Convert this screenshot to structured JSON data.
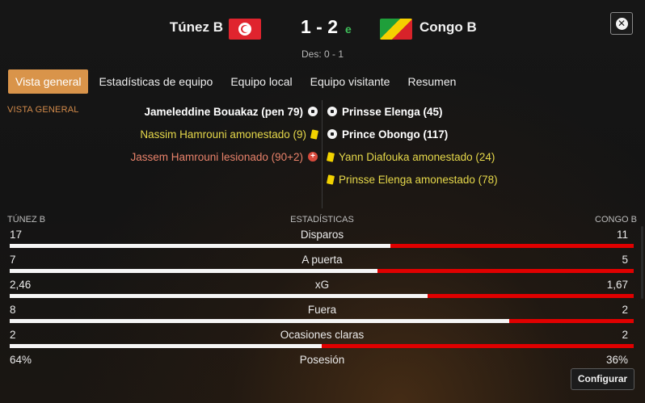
{
  "header": {
    "home_team": "Túnez B",
    "away_team": "Congo B",
    "score": "1 - 2",
    "score_tag": "e",
    "halftime": "Des: 0 - 1",
    "home_flag_icon": "tunisia-flag-icon",
    "away_flag_icon": "congo-flag-icon",
    "close_icon": "close-icon"
  },
  "tabs": [
    {
      "label": "Vista general",
      "active": true
    },
    {
      "label": "Estadísticas de equipo",
      "active": false
    },
    {
      "label": "Equipo local",
      "active": false
    },
    {
      "label": "Equipo visitante",
      "active": false
    },
    {
      "label": "Resumen",
      "active": false
    }
  ],
  "overview": {
    "section_label": "VISTA GENERAL",
    "home_events": [
      {
        "text": "Jameleddine Bouakaz (pen 79)",
        "type": "goal",
        "icon": "ball-icon"
      },
      {
        "text": "Nassim Hamrouni amonestado (9)",
        "type": "yellow",
        "icon": "yellow-card-icon"
      },
      {
        "text": "Jassem Hamrouni lesionado (90+2)",
        "type": "injury",
        "icon": "injury-icon"
      }
    ],
    "away_events": [
      {
        "text": "Prinsse Elenga (45)",
        "type": "goal",
        "icon": "ball-icon"
      },
      {
        "text": "Prince Obongo (117)",
        "type": "goal",
        "icon": "ball-icon"
      },
      {
        "text": "Yann Diafouka amonestado (24)",
        "type": "yellow",
        "icon": "yellow-card-icon"
      },
      {
        "text": "Prinsse Elenga amonestado (78)",
        "type": "yellow",
        "icon": "yellow-card-icon"
      }
    ]
  },
  "stats": {
    "home_label": "TÚNEZ B",
    "title": "ESTADÍSTICAS",
    "away_label": "CONGO B",
    "home_color": "#f5f5f5",
    "away_color": "#e00000",
    "rows": [
      {
        "name": "Disparos",
        "home": "17",
        "away": "11",
        "bar": true,
        "home_share": 0.61
      },
      {
        "name": "A puerta",
        "home": "7",
        "away": "5",
        "bar": true,
        "home_share": 0.59
      },
      {
        "name": "xG",
        "home": "2,46",
        "away": "1,67",
        "bar": true,
        "home_share": 0.67
      },
      {
        "name": "Fuera",
        "home": "8",
        "away": "2",
        "bar": true,
        "home_share": 0.8
      },
      {
        "name": "Ocasiones claras",
        "home": "2",
        "away": "2",
        "bar": true,
        "home_share": 0.5
      },
      {
        "name": "Posesión",
        "home": "64%",
        "away": "36%",
        "bar": false,
        "home_share": 0.64
      }
    ]
  },
  "configure_button": "Configurar"
}
